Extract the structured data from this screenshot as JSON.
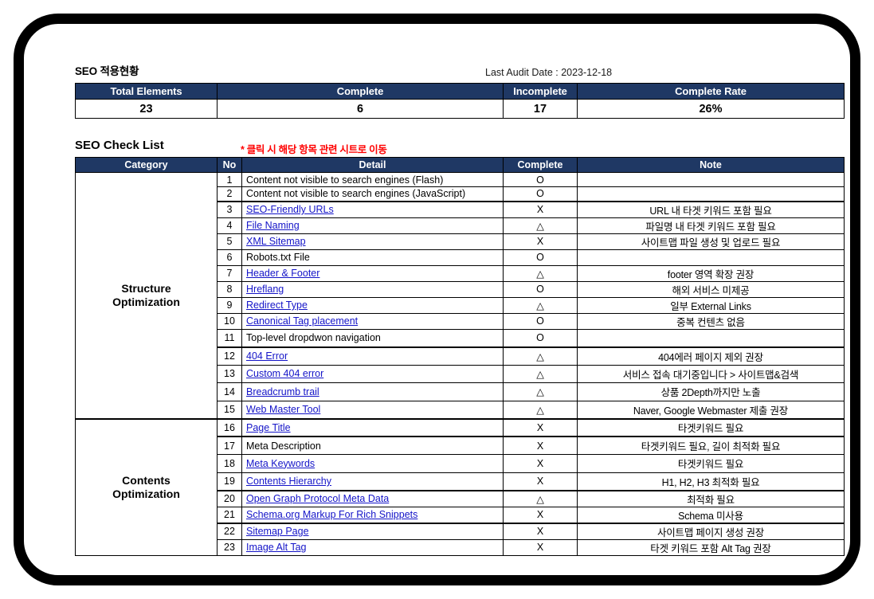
{
  "summary": {
    "title": "SEO 적용현황",
    "audit_date": "Last Audit Date : 2023-12-18",
    "headers": [
      "Total Elements",
      "Complete",
      "Incomplete",
      "Complete Rate"
    ],
    "values": [
      "23",
      "6",
      "17",
      "26%"
    ]
  },
  "checklist": {
    "title": "SEO Check List",
    "hint": "* 클릭 시 해당 항목 관련 시트로 이동",
    "headers": [
      "Category",
      "No",
      "Detail",
      "Complete",
      "Note"
    ],
    "categories": [
      {
        "label": "Structure\nOptimization",
        "line1": "Structure",
        "line2": "Optimization",
        "span": 15
      },
      {
        "label": "Contents\nOptimization",
        "line1": "Contents",
        "line2": "Optimization",
        "span": 8
      }
    ],
    "rows": [
      {
        "no": "1",
        "detail": "Content not visible to search engines (Flash)",
        "link": false,
        "complete": "O",
        "note": ""
      },
      {
        "no": "2",
        "detail": "Content not visible to search engines (JavaScript)",
        "link": false,
        "complete": "O",
        "note": ""
      },
      {
        "no": "3",
        "detail": "SEO-Friendly URLs",
        "link": true,
        "complete": "X",
        "note": "URL 내 타겟 키워드 포함 필요"
      },
      {
        "no": "4",
        "detail": "File Naming",
        "link": true,
        "complete": "△",
        "note": "파일명 내 타겟 키워드 포함 필요"
      },
      {
        "no": "5",
        "detail": "XML Sitemap",
        "link": true,
        "complete": "X",
        "note": "사이트맵 파일 생성 및 업로드 필요"
      },
      {
        "no": "6",
        "detail": "Robots.txt File",
        "link": false,
        "complete": "O",
        "note": ""
      },
      {
        "no": "7",
        "detail": "Header & Footer",
        "link": true,
        "complete": "△",
        "note": "footer 영역 확장 권장"
      },
      {
        "no": "8",
        "detail": "Hreflang",
        "link": true,
        "complete": "O",
        "note": "해외 서비스 미제공"
      },
      {
        "no": "9",
        "detail": "Redirect Type",
        "link": true,
        "complete": "△",
        "note": "일부 External Links"
      },
      {
        "no": "10",
        "detail": "Canonical Tag placement",
        "link": true,
        "complete": "O",
        "note": "중복 컨텐츠 없음"
      },
      {
        "no": "11",
        "detail": "Top-level dropdwon navigation",
        "link": false,
        "complete": "O",
        "note": ""
      },
      {
        "no": "12",
        "detail": "404 Error",
        "link": true,
        "complete": "△",
        "note": "404에러 페이지 제외 권장"
      },
      {
        "no": "13",
        "detail": "Custom 404 error",
        "link": true,
        "complete": "△",
        "note": "서비스 접속 대기중입니다 > 사이트맵&검색"
      },
      {
        "no": "14",
        "detail": "Breadcrumb trail",
        "link": true,
        "complete": "△",
        "note": "상품 2Depth까지만 노출"
      },
      {
        "no": "15",
        "detail": "Web Master Tool",
        "link": true,
        "complete": "△",
        "note": "Naver, Google Webmaster 제출 권장"
      },
      {
        "no": "16",
        "detail": "Page Title",
        "link": true,
        "complete": "X",
        "note": "타겟키워드 필요"
      },
      {
        "no": "17",
        "detail": "Meta Description",
        "link": false,
        "complete": "X",
        "note": "타겟키워드 필요, 길이 최적화 필요"
      },
      {
        "no": "18",
        "detail": "Meta Keywords",
        "link": true,
        "complete": "X",
        "note": "타겟키워드 필요"
      },
      {
        "no": "19",
        "detail": "Contents Hierarchy",
        "link": true,
        "complete": "X",
        "note": "H1, H2, H3 최적화 필요"
      },
      {
        "no": "20",
        "detail": "Open Graph Protocol Meta Data",
        "link": true,
        "complete": "△",
        "note": "최적화 필요"
      },
      {
        "no": "21",
        "detail": "Schema.org Markup For Rich Snippets",
        "link": true,
        "complete": "X",
        "note": "Schema 미사용"
      },
      {
        "no": "22",
        "detail": "Sitemap Page",
        "link": true,
        "complete": "X",
        "note": "사이트맵 페이지 생성 권장"
      },
      {
        "no": "23",
        "detail": "Image Alt Tag",
        "link": true,
        "complete": "X",
        "note": "타겟 키워드 포함 Alt Tag 권장"
      }
    ]
  },
  "colors": {
    "header_navy": "#1F3864",
    "link_blue": "#1414C8",
    "hint_red": "#FF0000",
    "frame_black": "#000000"
  }
}
